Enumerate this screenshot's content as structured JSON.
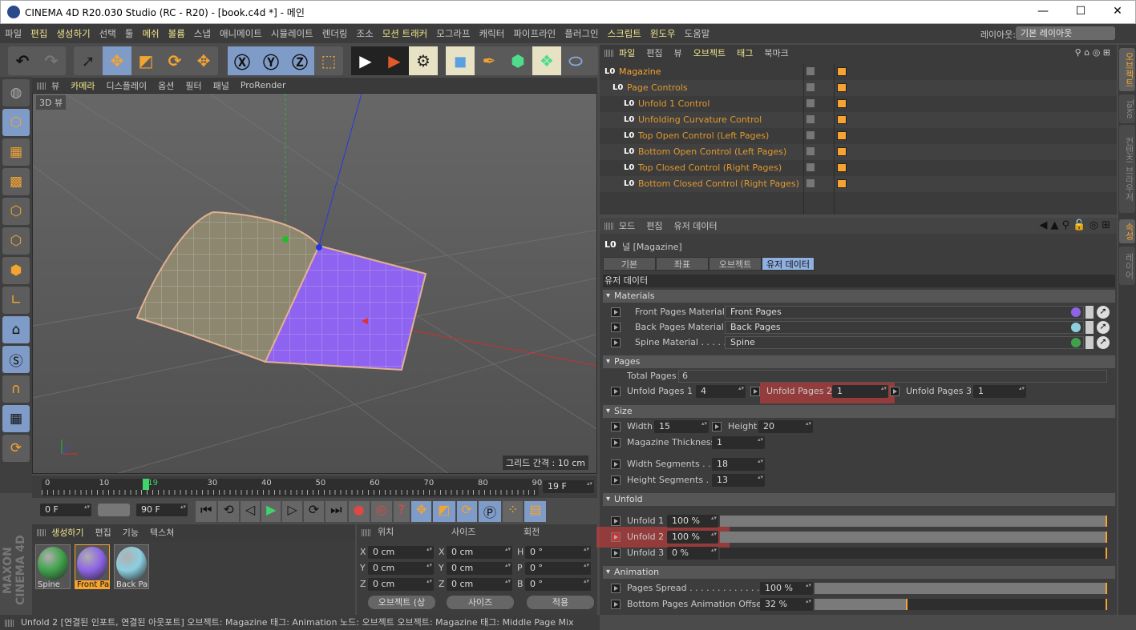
{
  "window": {
    "title": "CINEMA 4D R20.030 Studio (RC - R20) - [book.c4d *] - 메인",
    "minimize": "—",
    "maximize": "☐",
    "close": "✕"
  },
  "menu": [
    "파일",
    "편집",
    "생성하기",
    "선택",
    "툴",
    "메쉬",
    "볼륨",
    "스냅",
    "애니메이트",
    "시뮬레이트",
    "렌더링",
    "조소",
    "모션 트래커",
    "모그라프",
    "캐릭터",
    "파이프라인",
    "플러그인",
    "스크립트",
    "윈도우",
    "도움말"
  ],
  "layout": {
    "label": "레이아웃:",
    "value": "기본 레이아웃"
  },
  "viewport": {
    "menu": [
      "뷰",
      "카메라",
      "디스플레이",
      "옵션",
      "필터",
      "패널",
      "ProRender"
    ],
    "name": "3D 뷰",
    "grid": "그리드 간격 : 10 cm",
    "colors": {
      "front": "#8e63f0",
      "back": "#8d8770"
    }
  },
  "timeline": {
    "ticks": [
      "0",
      "10",
      "19",
      "30",
      "40",
      "50",
      "60",
      "70",
      "80",
      "90"
    ],
    "current_frame": 19,
    "current": "19 F",
    "start": "0 F",
    "end": "90 F"
  },
  "materials": {
    "menu": [
      "생성하기",
      "편집",
      "기능",
      "텍스쳐"
    ],
    "items": [
      {
        "name": "Spine",
        "color": "#3fa24a"
      },
      {
        "name": "Front Pa",
        "color": "#8e63e6"
      },
      {
        "name": "Back Pa",
        "color": "#8ccfe0"
      }
    ]
  },
  "coords": {
    "headers": [
      "위치",
      "사이즈",
      "회전"
    ],
    "rows": [
      [
        "X",
        "0 cm",
        "X",
        "0 cm",
        "H",
        "0 °"
      ],
      [
        "Y",
        "0 cm",
        "Y",
        "0 cm",
        "P",
        "0 °"
      ],
      [
        "Z",
        "0 cm",
        "Z",
        "0 cm",
        "B",
        "0 °"
      ]
    ],
    "mode": "오브젝트 (상",
    "size_mode": "사이즈",
    "apply": "적용"
  },
  "status": "Unfold 2 [연결된 인포트, 연결된 아웃포트] 오브젝트: Magazine  태그: Animation  노드: 오브젝트 오브젝트: Magazine  태그: Middle Page Mix",
  "object_manager": {
    "menu": [
      "파일",
      "편집",
      "뷰",
      "오브젝트",
      "태그",
      "북마크"
    ],
    "objects": [
      "Magazine",
      "Page Controls",
      "Unfold 1 Control",
      "Unfolding Curvature Control",
      "Top Open Control (Left Pages)",
      "Bottom Open Control (Left Pages)",
      "Top Closed Control (Right Pages)",
      "Bottom Closed Control (Right Pages)"
    ]
  },
  "attributes": {
    "menu": [
      "모드",
      "편집",
      "유저 데이터"
    ],
    "object": "널 [Magazine]",
    "tabs": [
      "기본",
      "좌표",
      "오브젝트",
      "유저 데이터"
    ],
    "active_tab": "유저 데이터",
    "section_title": "유저 데이터",
    "materials": {
      "title": "Materials",
      "rows": [
        {
          "label": "Front Pages Material",
          "value": "Front Pages"
        },
        {
          "label": "Back Pages Material",
          "value": "Back Pages"
        },
        {
          "label": "Spine Material . . . . .",
          "value": "Spine"
        }
      ]
    },
    "pages": {
      "title": "Pages",
      "total_label": "Total Pages",
      "total": "6",
      "u1_label": "Unfold Pages 1",
      "u1": "4",
      "u2_label": "Unfold Pages 2",
      "u2": "1",
      "u3_label": "Unfold Pages 3",
      "u3": "1"
    },
    "size": {
      "title": "Size",
      "width_label": "Width",
      "width": "15",
      "height_label": "Height",
      "height": "20",
      "thick_label": "Magazine Thickness",
      "thick": "1",
      "wseg_label": "Width Segments . .",
      "wseg": "18",
      "hseg_label": "Height Segments . .",
      "hseg": "13"
    },
    "unfold": {
      "title": "Unfold",
      "rows": [
        {
          "label": "Unfold 1",
          "value": "100 %",
          "pct": 100
        },
        {
          "label": "Unfold 2",
          "value": "100 %",
          "pct": 100
        },
        {
          "label": "Unfold 3",
          "value": "0 %",
          "pct": 0
        }
      ]
    },
    "animation": {
      "title": "Animation",
      "rows": [
        {
          "label": "Pages Spread . . . . . . . . . . . . . .",
          "value": "100 %",
          "pct": 100
        },
        {
          "label": "Bottom Pages Animation Offset",
          "value": "32 %",
          "pct": 32
        }
      ]
    }
  },
  "side_tabs": [
    "오브젝트",
    "Take",
    "컨텐츠 브라우저",
    "속성",
    "레이어"
  ],
  "accent": "#f4a430"
}
